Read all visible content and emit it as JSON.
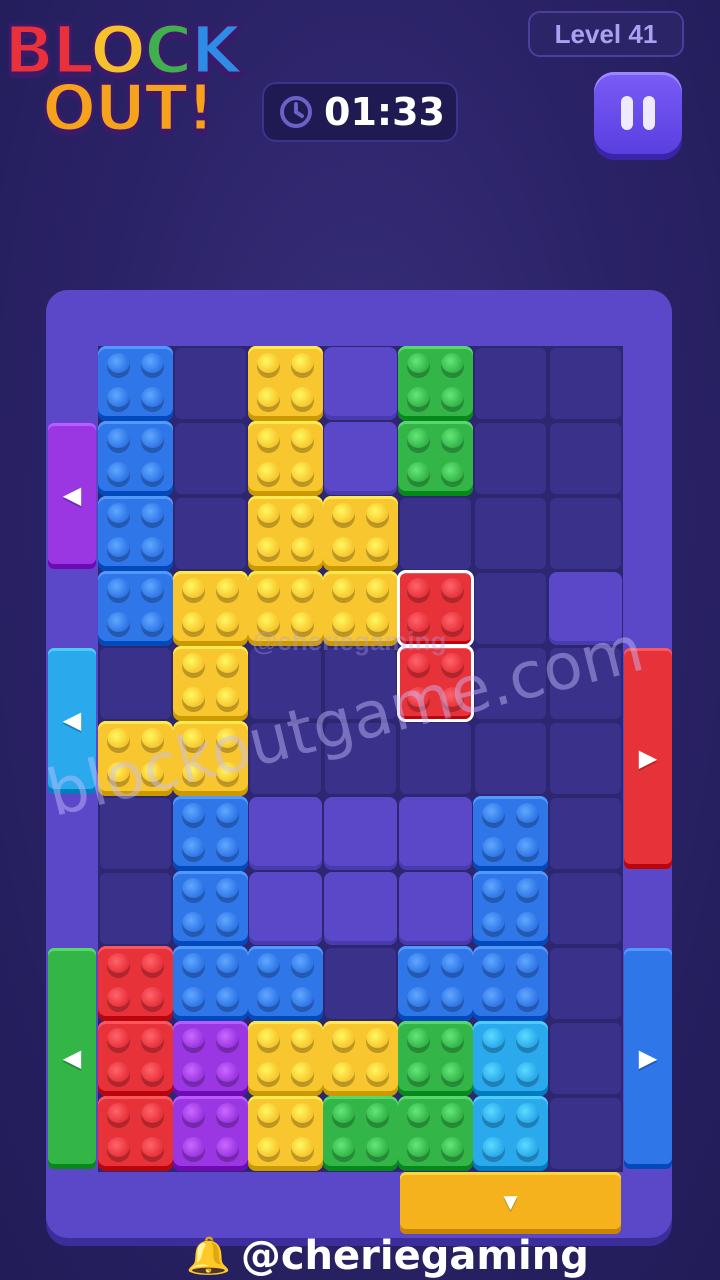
{
  "logo": {
    "line1": [
      "BL",
      "O",
      "C",
      "K"
    ],
    "line2": [
      "OUT!"
    ]
  },
  "header": {
    "level_label": "Level 41",
    "timer": "01:33",
    "timer_icon": "clock-icon",
    "pause_icon": "pause-icon"
  },
  "watermarks": {
    "small": "@cheriegaming",
    "large": "blockoutgame.com"
  },
  "footer": {
    "credit": "@cheriegaming",
    "icon": "bell-icon"
  },
  "colors": {
    "blue": "#2f76e8",
    "yellow": "#f8c62e",
    "green": "#33b548",
    "red": "#e8323a",
    "purple": "#9a36e2",
    "cyan": "#2aa9ec",
    "orange": "#f6b21c"
  },
  "board": {
    "cols": 7,
    "rows": 11,
    "walls": [
      [
        3,
        0
      ],
      [
        3,
        1
      ],
      [
        0,
        3
      ],
      [
        6,
        3
      ],
      [
        2,
        6
      ],
      [
        3,
        6
      ],
      [
        4,
        6
      ],
      [
        2,
        7
      ],
      [
        3,
        7
      ],
      [
        4,
        7
      ]
    ],
    "blocks": [
      {
        "color": "blue",
        "cells": [
          [
            0,
            0
          ],
          [
            0,
            1
          ],
          [
            0,
            2
          ],
          [
            0,
            3
          ]
        ]
      },
      {
        "color": "yellow",
        "cells": [
          [
            2,
            0
          ],
          [
            2,
            1
          ],
          [
            2,
            2
          ],
          [
            3,
            2
          ],
          [
            2,
            3
          ],
          [
            3,
            3
          ]
        ]
      },
      {
        "color": "green",
        "cells": [
          [
            4,
            0
          ],
          [
            4,
            1
          ]
        ]
      },
      {
        "color": "yellow",
        "cells": [
          [
            1,
            3
          ],
          [
            1,
            4
          ],
          [
            1,
            5
          ],
          [
            0,
            5
          ]
        ]
      },
      {
        "color": "red",
        "cells": [
          [
            4,
            3
          ],
          [
            4,
            4
          ]
        ],
        "selected": true
      },
      {
        "color": "blue",
        "cells": [
          [
            1,
            6
          ],
          [
            1,
            7
          ],
          [
            1,
            8
          ],
          [
            2,
            8
          ]
        ]
      },
      {
        "color": "blue",
        "cells": [
          [
            5,
            6
          ],
          [
            5,
            7
          ],
          [
            5,
            8
          ],
          [
            4,
            8
          ]
        ]
      },
      {
        "color": "red",
        "cells": [
          [
            0,
            8
          ],
          [
            0,
            9
          ],
          [
            0,
            10
          ]
        ]
      },
      {
        "color": "purple",
        "cells": [
          [
            1,
            9
          ],
          [
            1,
            10
          ]
        ]
      },
      {
        "color": "yellow",
        "cells": [
          [
            2,
            9
          ],
          [
            3,
            9
          ],
          [
            2,
            10
          ]
        ]
      },
      {
        "color": "green",
        "cells": [
          [
            4,
            9
          ],
          [
            3,
            10
          ],
          [
            4,
            10
          ]
        ]
      },
      {
        "color": "cyan",
        "cells": [
          [
            5,
            9
          ],
          [
            5,
            10
          ]
        ]
      }
    ],
    "gates": [
      {
        "color": "purple",
        "side": "left",
        "start": 1,
        "span": 2,
        "arrow": "◀"
      },
      {
        "color": "cyan",
        "side": "left",
        "start": 4,
        "span": 2,
        "arrow": "◀"
      },
      {
        "color": "green",
        "side": "left",
        "start": 8,
        "span": 3,
        "arrow": "◀"
      },
      {
        "color": "red",
        "side": "right",
        "start": 4,
        "span": 3,
        "arrow": "▶"
      },
      {
        "color": "blue",
        "side": "right",
        "start": 8,
        "span": 3,
        "arrow": "▶"
      },
      {
        "color": "orange",
        "side": "bottom",
        "start": 4,
        "span": 3,
        "arrow": "▼"
      }
    ]
  }
}
